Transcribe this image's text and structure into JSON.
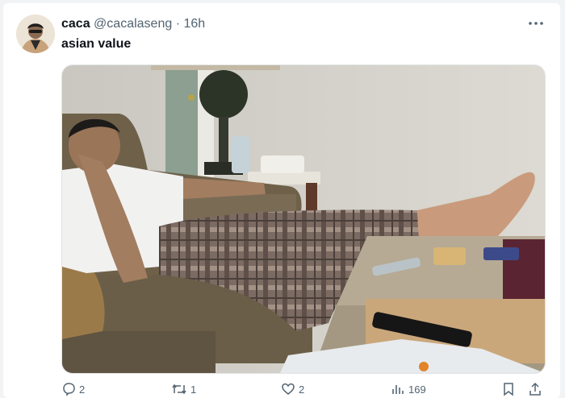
{
  "tweet": {
    "display_name": "caca",
    "handle": "@cacalaseng",
    "separator": "·",
    "time": "16h",
    "text": "asian value",
    "more_icon": "more-dots-icon"
  },
  "actions": {
    "reply_count": "2",
    "retweet_count": "1",
    "like_count": "2",
    "views_count": "169",
    "icons": [
      "reply-icon",
      "retweet-icon",
      "like-icon",
      "views-icon",
      "bookmark-icon",
      "share-icon"
    ]
  },
  "colors": {
    "text_primary": "#0f1419",
    "text_secondary": "#536471",
    "card_bg": "#ffffff",
    "page_bg": "#f2f3f4"
  }
}
